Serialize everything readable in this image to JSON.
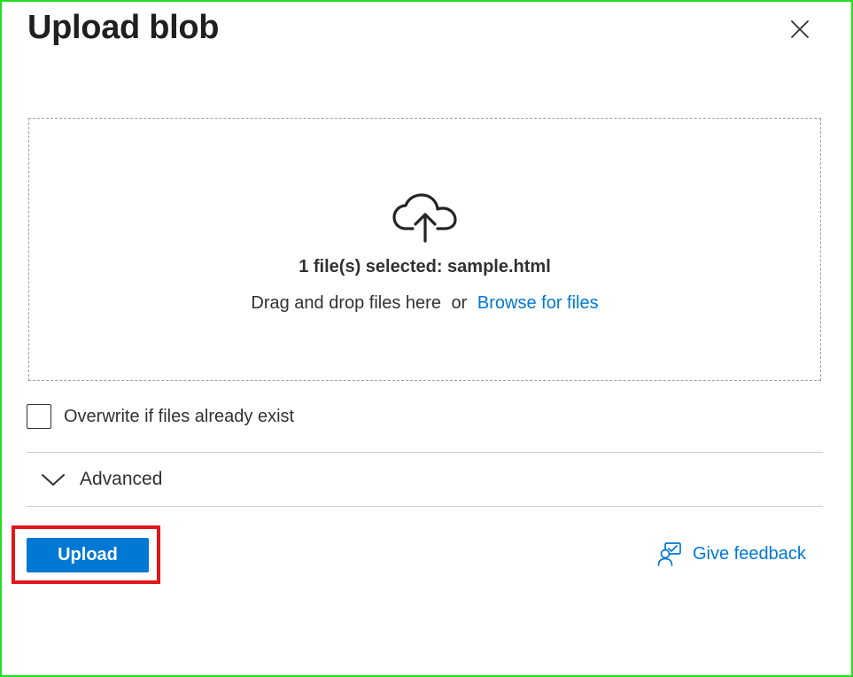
{
  "dialog": {
    "title": "Upload blob"
  },
  "dropzone": {
    "selected_text": "1 file(s) selected: sample.html",
    "drag_text": "Drag and drop files here",
    "or_text": "or",
    "browse_label": "Browse for files"
  },
  "options": {
    "overwrite_label": "Overwrite if files already exist",
    "overwrite_checked": false
  },
  "advanced": {
    "label": "Advanced"
  },
  "actions": {
    "upload_label": "Upload",
    "feedback_label": "Give feedback"
  },
  "icons": {
    "close": "close-icon",
    "upload": "cloud-upload-icon",
    "expand": "chevron-down-icon",
    "feedback": "feedback-icon"
  },
  "colors": {
    "accent": "#0078d4",
    "highlight": "#e0161b",
    "frame": "#22dd22"
  }
}
